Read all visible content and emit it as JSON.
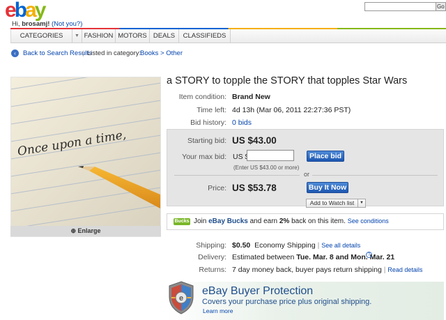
{
  "header": {
    "logo": "ebay",
    "greeting_prefix": "Hi, ",
    "username": "brosamj!",
    "not_you": "(Not you?)",
    "search_button": "Go"
  },
  "nav": {
    "items": [
      "CATEGORIES",
      "FASHION",
      "MOTORS",
      "DEALS",
      "CLASSIFIEDS"
    ]
  },
  "breadcrumb": {
    "back": "Back to Search Results",
    "separator": "|",
    "listed_label": "Listed in category:",
    "category": "Books > Other"
  },
  "image": {
    "caption": "Once upon a time,",
    "enlarge": "Enlarge"
  },
  "item": {
    "title": "a STORY to topple the STORY that topples Star Wars",
    "condition_label": "Item condition:",
    "condition_value": "Brand New",
    "time_left_label": "Time left:",
    "time_left_value": "4d 13h",
    "time_left_date": "(Mar 06, 2011 22:27:36 PST)",
    "bid_history_label": "Bid history:",
    "bid_history_value": "0 bids"
  },
  "bid": {
    "starting_label": "Starting bid:",
    "starting_value": "US $43.00",
    "max_label": "Your max bid:",
    "currency": "US $",
    "input_value": "",
    "hint": "(Enter US $43.00 or more)",
    "place_bid": "Place bid",
    "or": "or",
    "price_label": "Price:",
    "price_value": "US $53.78",
    "buy_now": "Buy It Now",
    "watch": "Add to Watch list"
  },
  "bucks": {
    "badge": "Bucks",
    "join": "Join ",
    "brand": "eBay Bucks",
    "earn": " and earn ",
    "pct": "2%",
    "rest": " back on this item.",
    "link": "See conditions"
  },
  "shipping": {
    "shipping_label": "Shipping:",
    "shipping_cost": "$0.50",
    "shipping_method": "Economy Shipping",
    "shipping_sep": "|",
    "shipping_link": "See all details",
    "delivery_label": "Delivery:",
    "delivery_prefix": "Estimated between ",
    "delivery_dates": "Tue. Mar. 8 and Mon. Mar. 21",
    "returns_label": "Returns:",
    "returns_value": "7 day money back, buyer pays return shipping",
    "returns_sep": "|",
    "returns_link": "Read details"
  },
  "protection": {
    "title": "eBay Buyer Protection",
    "subtitle": "Covers your purchase price plus original shipping.",
    "learn": "Learn more"
  }
}
